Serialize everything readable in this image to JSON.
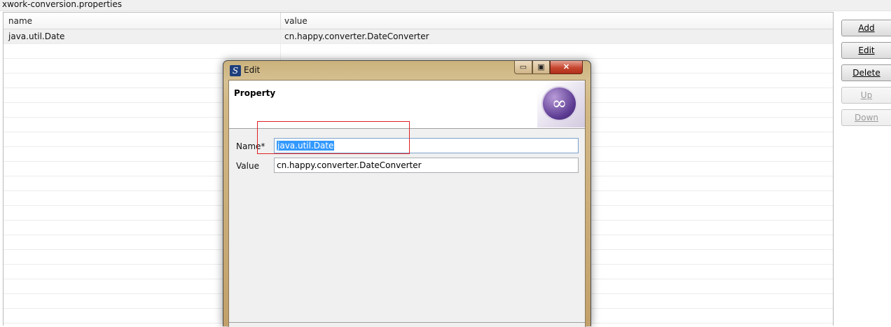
{
  "editor": {
    "file_title": "xwork-conversion.properties",
    "columns": [
      "name",
      "value"
    ],
    "rows": [
      {
        "name": "java.util.Date",
        "value": "cn.happy.converter.DateConverter"
      }
    ],
    "empty_row_count": 19,
    "buttons": {
      "add": "Add",
      "edit": "Edit",
      "delete": "Delete",
      "up": "Up",
      "down": "Down"
    }
  },
  "dialog": {
    "title": "Edit",
    "heading": "Property",
    "app_icon": "eclipse-s-icon",
    "logo": "eclipse-logo-icon",
    "window_buttons": {
      "minimize": "▭",
      "maximize": "▣",
      "close": "✕"
    },
    "fields": {
      "name_label": "Name*",
      "name_value": "java.util.Date",
      "value_label": "Value",
      "value_value": "cn.happy.converter.DateConverter"
    }
  },
  "colors": {
    "selection": "#3399ff",
    "annotation": "#e02020",
    "titlebar": "#d7c193"
  }
}
